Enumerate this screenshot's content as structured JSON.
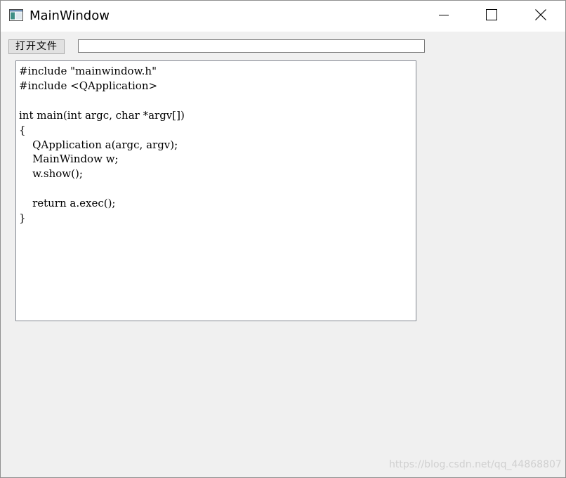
{
  "window": {
    "title": "MainWindow",
    "icon": "qt-window-icon"
  },
  "titlebar_controls": {
    "minimize_icon": "minimize-icon",
    "maximize_icon": "maximize-icon",
    "close_icon": "close-icon"
  },
  "toolbar": {
    "open_file_label": "打开文件",
    "path_value": ""
  },
  "editor": {
    "content": "#include \"mainwindow.h\"\n#include <QApplication>\n\nint main(int argc, char *argv[])\n{\n    QApplication a(argc, argv);\n    MainWindow w;\n    w.show();\n\n    return a.exec();\n}"
  },
  "watermark": {
    "text": "https://blog.csdn.net/qq_44868807"
  },
  "colors": {
    "window_bg": "#f0f0f0",
    "titlebar_bg": "#ffffff",
    "button_bg": "#e1e1e1",
    "watermark": "#d0d0d0"
  }
}
